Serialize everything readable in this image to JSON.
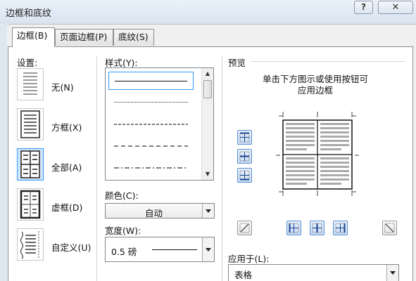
{
  "window": {
    "title": "边框和底纹",
    "help_label": "?",
    "close_label": "✕"
  },
  "tabs": [
    {
      "label": "边框(B)",
      "active": true
    },
    {
      "label": "页面边框(P)",
      "active": false
    },
    {
      "label": "底纹(S)",
      "active": false
    }
  ],
  "settings": {
    "heading": "设置:",
    "items": [
      {
        "label": "无(N)",
        "icon": "border-none-icon",
        "selected": false
      },
      {
        "label": "方框(X)",
        "icon": "border-box-icon",
        "selected": false
      },
      {
        "label": "全部(A)",
        "icon": "border-all-icon",
        "selected": true
      },
      {
        "label": "虚框(D)",
        "icon": "border-grid-icon",
        "selected": false
      },
      {
        "label": "自定义(U)",
        "icon": "border-custom-icon",
        "selected": false
      }
    ]
  },
  "style": {
    "heading": "样式(Y):",
    "options": [
      "solid",
      "dotted",
      "dashed-fine",
      "dashed",
      "dash-dot"
    ],
    "selected_index": 0
  },
  "color": {
    "heading": "颜色(C):",
    "value": "自动"
  },
  "width": {
    "heading": "宽度(W):",
    "value": "0.5 磅"
  },
  "preview": {
    "heading": "预览",
    "hint_line1": "单击下方图示或使用按钮可",
    "hint_line2": "应用边框"
  },
  "apply_to": {
    "heading": "应用于(L):",
    "value": "表格"
  },
  "colors": {
    "accent_border": "#3399ff",
    "selected_fill": "#d2e6fb",
    "window_frame": "#dfe7f1"
  }
}
